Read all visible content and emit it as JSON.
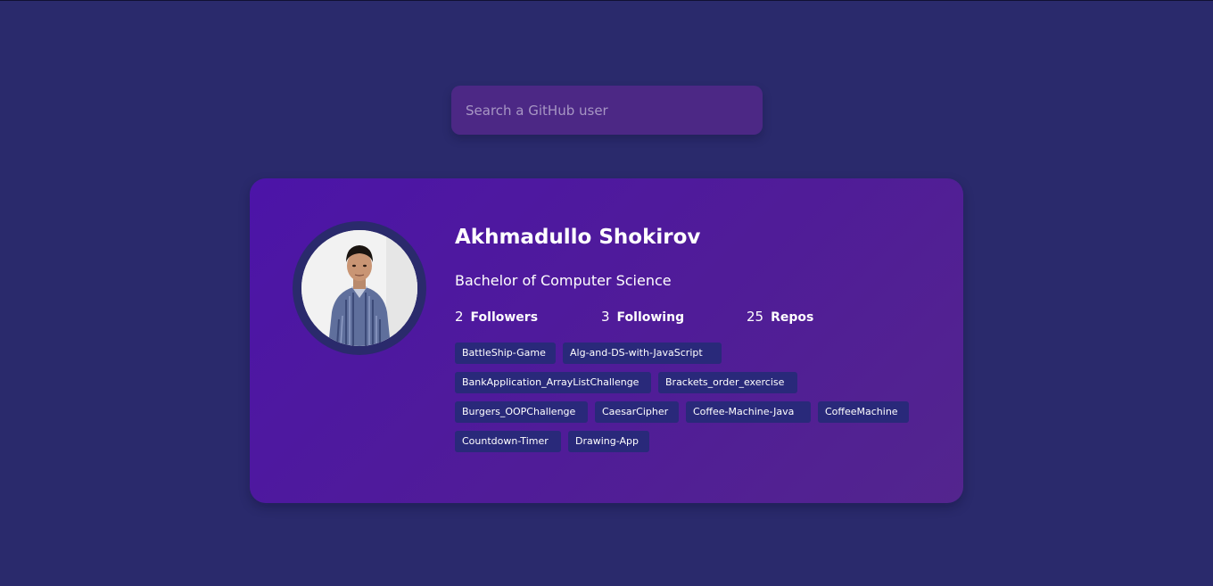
{
  "search": {
    "placeholder": "Search a GitHub user",
    "value": ""
  },
  "profile": {
    "name": "Akhmadullo Shokirov",
    "bio": "Bachelor of Computer Science",
    "stats": [
      {
        "count": "2",
        "label": "Followers"
      },
      {
        "count": "3",
        "label": "Following"
      },
      {
        "count": "25",
        "label": "Repos"
      }
    ],
    "repos": [
      "BattleShip-Game",
      "Alg-and-DS-with-JavaScript",
      "BankApplication_ArrayListChallenge",
      "Brackets_order_exercise",
      "Burgers_OOPChallenge",
      "CaesarCipher",
      "Coffee-Machine-Java",
      "CoffeeMachine",
      "Countdown-Timer",
      "Drawing-App"
    ]
  },
  "colors": {
    "background": "#2a2a6c",
    "card": "#4c14a8",
    "search_field": "#4c2885",
    "repo_tag": "#29297a"
  }
}
